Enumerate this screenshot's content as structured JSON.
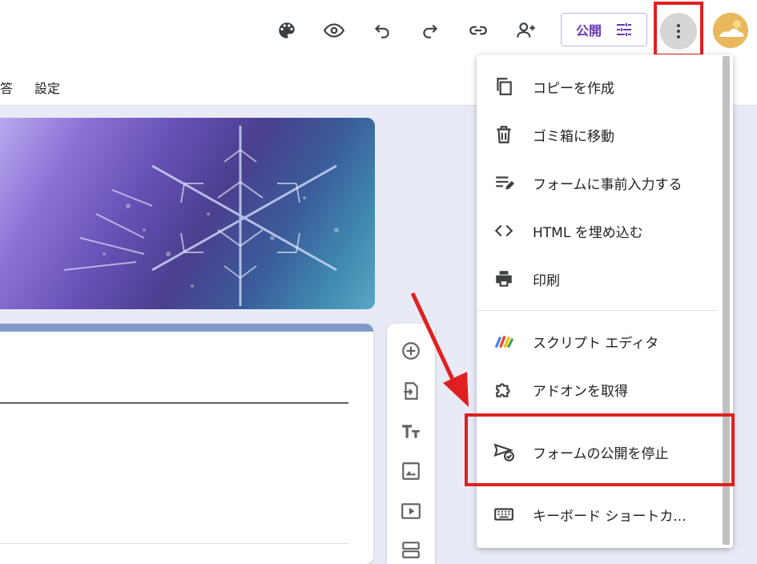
{
  "header": {
    "publish_label": "公開",
    "tabs": [
      "答",
      "設定"
    ]
  },
  "toolbar_icons": [
    "palette-icon",
    "preview-eye-icon",
    "undo-icon",
    "redo-icon",
    "link-icon",
    "add-collaborator-icon"
  ],
  "menu": {
    "items": [
      {
        "label": "コピーを作成",
        "icon": "copy-icon"
      },
      {
        "label": "ゴミ箱に移動",
        "icon": "trash-icon"
      },
      {
        "label": "フォームに事前入力する",
        "icon": "prefill-icon"
      },
      {
        "label": "HTML を埋め込む",
        "icon": "code-icon"
      },
      {
        "label": "印刷",
        "icon": "print-icon"
      },
      {
        "label": "スクリプト エディタ",
        "icon": "apps-script-icon"
      },
      {
        "label": "アドオンを取得",
        "icon": "puzzle-icon"
      },
      {
        "label": "フォームの公開を停止",
        "icon": "unpublish-icon"
      },
      {
        "label": "キーボード ショートカ...",
        "icon": "keyboard-icon"
      }
    ]
  },
  "colors": {
    "accent": "#673ab7",
    "highlight": "#e02020",
    "canvas": "#e8eaf6"
  }
}
